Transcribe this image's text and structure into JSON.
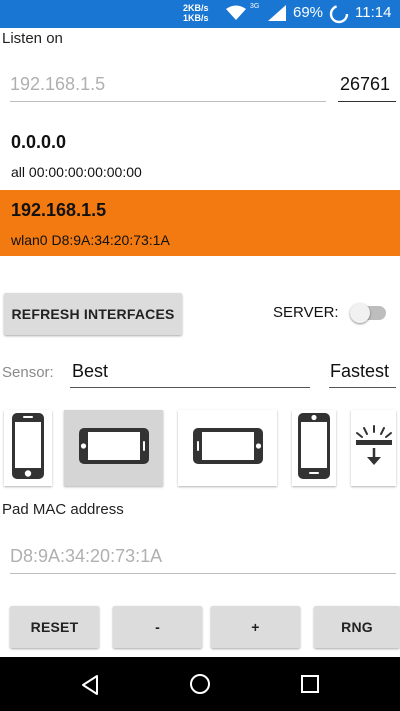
{
  "status_bar": {
    "net_up": "2KB/s",
    "net_down": "1KB/s",
    "battery_percent": "69%",
    "time": "11:14",
    "icons": [
      "wifi-icon",
      "signal-icon",
      "battery-icon"
    ]
  },
  "listen": {
    "title": "Listen on",
    "ip_placeholder": "192.168.1.5",
    "port_value": "26761"
  },
  "interfaces": [
    {
      "ip": "0.0.0.0",
      "name": "all",
      "mac": "00:00:00:00:00:00",
      "selected": false
    },
    {
      "ip": "192.168.1.5",
      "name": "wlan0",
      "mac": "D8:9A:34:20:73:1A",
      "selected": true
    }
  ],
  "controls": {
    "refresh_label": "REFRESH INTERFACES",
    "server_label": "SERVER:",
    "server_on": false
  },
  "sensor": {
    "label": "Sensor:",
    "value": "Best",
    "speed": "Fastest"
  },
  "orientations": [
    {
      "icon": "phone-portrait-icon",
      "active": false
    },
    {
      "icon": "phone-landscape-icon",
      "active": true
    },
    {
      "icon": "phone-landscape-icon",
      "active": false
    },
    {
      "icon": "phone-portrait-icon",
      "active": false
    },
    {
      "icon": "flat-face-up-icon",
      "active": false
    }
  ],
  "pad": {
    "label": "Pad MAC address",
    "mac_placeholder": "D8:9A:34:20:73:1A"
  },
  "actions": {
    "reset": "RESET",
    "minus": "-",
    "plus": "+",
    "rng": "RNG"
  },
  "colors": {
    "status_bar": "#1976d2",
    "selected_row": "#f37a10"
  }
}
